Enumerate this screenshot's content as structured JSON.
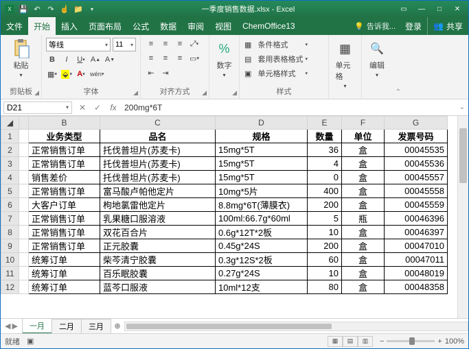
{
  "title": "一季度销售数据.xlsx - Excel",
  "qat": [
    "save",
    "undo",
    "redo",
    "touch",
    "folder"
  ],
  "win": {
    "min": "—",
    "max": "□",
    "close": "✕"
  },
  "menu": {
    "file": "文件",
    "home": "开始",
    "insert": "插入",
    "layout": "页面布局",
    "formulas": "公式",
    "data": "数据",
    "review": "审阅",
    "view": "视图",
    "chem": "ChemOffice13",
    "tell": "告诉我...",
    "login": "登录",
    "share": "共享"
  },
  "ribbon": {
    "clipboard": {
      "paste": "粘贴",
      "label": "剪贴板"
    },
    "font": {
      "name": "等线",
      "size": "11",
      "label": "字体"
    },
    "align": {
      "label": "对齐方式"
    },
    "number": {
      "btn": "数字",
      "label": ""
    },
    "styles": {
      "cond": "条件格式",
      "table": "套用表格格式",
      "cell": "单元格样式",
      "label": "样式"
    },
    "cells": {
      "btn": "单元格"
    },
    "edit": {
      "btn": "编辑"
    }
  },
  "fmla": {
    "name": "D21",
    "value": "200mg*6T"
  },
  "cols": {
    "A": "",
    "B": "B",
    "C": "C",
    "D": "D",
    "E": "E",
    "F": "F",
    "G": "G"
  },
  "headers": {
    "b": "业务类型",
    "c": "品名",
    "d": "规格",
    "e": "数量",
    "f": "单位",
    "g": "发票号码"
  },
  "rows": [
    {
      "n": "2",
      "b": "正常销售订单",
      "c": "托伐普坦片(苏麦卡)",
      "d": "15mg*5T",
      "e": "36",
      "f": "盒",
      "g": "00045535"
    },
    {
      "n": "3",
      "b": "正常销售订单",
      "c": "托伐普坦片(苏麦卡)",
      "d": "15mg*5T",
      "e": "4",
      "f": "盒",
      "g": "00045536"
    },
    {
      "n": "4",
      "b": "销售差价",
      "c": "托伐普坦片(苏麦卡)",
      "d": "15mg*5T",
      "e": "0",
      "f": "盒",
      "g": "00045557"
    },
    {
      "n": "5",
      "b": "正常销售订单",
      "c": "富马酸卢帕他定片",
      "d": "10mg*5片",
      "e": "400",
      "f": "盒",
      "g": "00045558"
    },
    {
      "n": "6",
      "b": "大客户订单",
      "c": "枸地氯雷他定片",
      "d": "8.8mg*6T(薄膜衣)",
      "e": "200",
      "f": "盒",
      "g": "00045559"
    },
    {
      "n": "7",
      "b": "正常销售订单",
      "c": "乳果糖口服溶液",
      "d": "100ml:66.7g*60ml",
      "e": "5",
      "f": "瓶",
      "g": "00046396"
    },
    {
      "n": "8",
      "b": "正常销售订单",
      "c": "双花百合片",
      "d": "0.6g*12T*2板",
      "e": "10",
      "f": "盒",
      "g": "00046397"
    },
    {
      "n": "9",
      "b": "正常销售订单",
      "c": "正元胶囊",
      "d": "0.45g*24S",
      "e": "200",
      "f": "盒",
      "g": "00047010"
    },
    {
      "n": "10",
      "b": "统筹订单",
      "c": "柴芩清宁胶囊",
      "d": "0.3g*12S*2板",
      "e": "60",
      "f": "盒",
      "g": "00047011"
    },
    {
      "n": "11",
      "b": "统筹订单",
      "c": "百乐眠胶囊",
      "d": "0.27g*24S",
      "e": "10",
      "f": "盒",
      "g": "00048019"
    },
    {
      "n": "12",
      "b": "统筹订单",
      "c": "蓝芩口服液",
      "d": "10ml*12支",
      "e": "80",
      "f": "盒",
      "g": "00048358"
    }
  ],
  "chart_data": {
    "type": "table",
    "title": "一季度销售数据",
    "columns": [
      "业务类型",
      "品名",
      "规格",
      "数量",
      "单位",
      "发票号码"
    ],
    "rows": [
      [
        "正常销售订单",
        "托伐普坦片(苏麦卡)",
        "15mg*5T",
        36,
        "盒",
        "00045535"
      ],
      [
        "正常销售订单",
        "托伐普坦片(苏麦卡)",
        "15mg*5T",
        4,
        "盒",
        "00045536"
      ],
      [
        "销售差价",
        "托伐普坦片(苏麦卡)",
        "15mg*5T",
        0,
        "盒",
        "00045557"
      ],
      [
        "正常销售订单",
        "富马酸卢帕他定片",
        "10mg*5片",
        400,
        "盒",
        "00045558"
      ],
      [
        "大客户订单",
        "枸地氯雷他定片",
        "8.8mg*6T(薄膜衣)",
        200,
        "盒",
        "00045559"
      ],
      [
        "正常销售订单",
        "乳果糖口服溶液",
        "100ml:66.7g*60ml",
        5,
        "瓶",
        "00046396"
      ],
      [
        "正常销售订单",
        "双花百合片",
        "0.6g*12T*2板",
        10,
        "盒",
        "00046397"
      ],
      [
        "正常销售订单",
        "正元胶囊",
        "0.45g*24S",
        200,
        "盒",
        "00047010"
      ],
      [
        "统筹订单",
        "柴芩清宁胶囊",
        "0.3g*12S*2板",
        60,
        "盒",
        "00047011"
      ],
      [
        "统筹订单",
        "百乐眠胶囊",
        "0.27g*24S",
        10,
        "盒",
        "00048019"
      ],
      [
        "统筹订单",
        "蓝芩口服液",
        "10ml*12支",
        80,
        "盒",
        "00048358"
      ]
    ]
  },
  "sheets": {
    "s1": "一月",
    "s2": "二月",
    "s3": "三月"
  },
  "status": {
    "ready": "就绪",
    "zoom": "100%"
  }
}
